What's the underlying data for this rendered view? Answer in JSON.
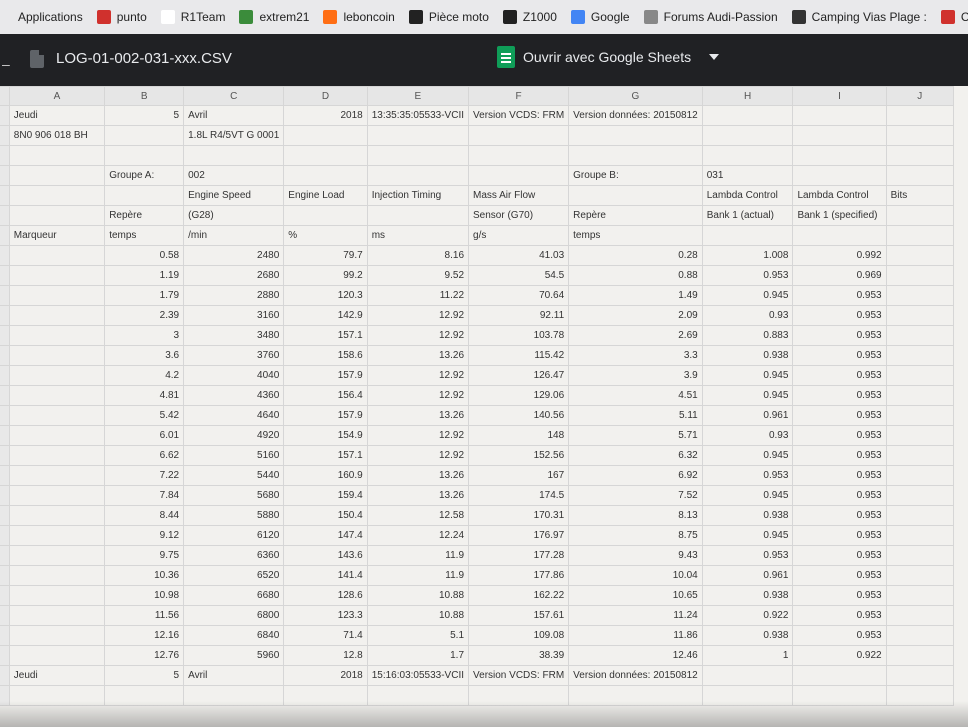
{
  "bookmarks": [
    {
      "label": "Applications",
      "icon": "apps-icon",
      "color": "#e9e9eb"
    },
    {
      "label": "punto",
      "icon": "fiat-icon",
      "color": "#d0312d"
    },
    {
      "label": "R1Team",
      "icon": "page-icon",
      "color": "#ffffff"
    },
    {
      "label": "extrem21",
      "icon": "extrem-icon",
      "color": "#3b8c3b"
    },
    {
      "label": "leboncoin",
      "icon": "leboncoin-icon",
      "color": "#ff6e14"
    },
    {
      "label": "Pièce moto",
      "icon": "moto-icon",
      "color": "#222222"
    },
    {
      "label": "Z1000",
      "icon": "z1000-icon",
      "color": "#222222"
    },
    {
      "label": "Google",
      "icon": "google-icon",
      "color": "#4285f4"
    },
    {
      "label": "Forums Audi-Passion",
      "icon": "audi-icon",
      "color": "#888888"
    },
    {
      "label": "Camping Vias Plage :",
      "icon": "camping-icon",
      "color": "#333333"
    },
    {
      "label": "Clés mix",
      "icon": "cles-icon",
      "color": "#d0312d"
    }
  ],
  "viewer": {
    "file_name": "LOG-01-002-031-xxx.CSV",
    "open_with_label": "Ouvrir avec Google Sheets",
    "sheets_color": "#0f9d58"
  },
  "sheet": {
    "columns": [
      "A",
      "B",
      "C",
      "D",
      "E",
      "F",
      "G",
      "H",
      "I",
      "J"
    ],
    "header_rows": [
      {
        "num": "",
        "cells": [
          [
            "Jeudi",
            "txt"
          ],
          [
            "5",
            "num"
          ],
          [
            "Avril",
            "txt"
          ],
          [
            "2018",
            "num"
          ],
          [
            "13:35:35:05533-VCII",
            "txt"
          ],
          [
            "Version VCDS: FRM",
            "txt"
          ],
          [
            "Version données: 20150812",
            "txt"
          ],
          [
            "",
            "txt"
          ],
          [
            "",
            "txt"
          ],
          [
            "",
            "txt"
          ]
        ]
      },
      {
        "num": "",
        "cells": [
          [
            "8N0 906 018 BH",
            "txt"
          ],
          [
            "",
            "txt"
          ],
          [
            "1.8L R4/5VT    G  0001",
            "txt"
          ],
          [
            "",
            "txt"
          ],
          [
            "",
            "txt"
          ],
          [
            "",
            "txt"
          ],
          [
            "",
            "txt"
          ],
          [
            "",
            "txt"
          ],
          [
            "",
            "txt"
          ],
          [
            "",
            "txt"
          ]
        ]
      },
      {
        "num": "",
        "cells": [
          [
            "",
            "txt"
          ],
          [
            "",
            "txt"
          ],
          [
            "",
            "txt"
          ],
          [
            "",
            "txt"
          ],
          [
            "",
            "txt"
          ],
          [
            "",
            "txt"
          ],
          [
            "",
            "txt"
          ],
          [
            "",
            "txt"
          ],
          [
            "",
            "txt"
          ],
          [
            "",
            "txt"
          ]
        ]
      },
      {
        "num": "",
        "cells": [
          [
            "",
            "txt"
          ],
          [
            "Groupe A:",
            "txt"
          ],
          [
            "002",
            "txt"
          ],
          [
            "",
            "txt"
          ],
          [
            "",
            "txt"
          ],
          [
            "",
            "txt"
          ],
          [
            "Groupe B:",
            "txt"
          ],
          [
            "031",
            "txt"
          ],
          [
            "",
            "txt"
          ],
          [
            "",
            "txt"
          ]
        ]
      },
      {
        "num": "",
        "cells": [
          [
            "",
            "txt"
          ],
          [
            "",
            "txt"
          ],
          [
            "Engine Speed",
            "txt"
          ],
          [
            "Engine Load",
            "txt"
          ],
          [
            "Injection Timing",
            "txt"
          ],
          [
            "Mass Air Flow",
            "txt"
          ],
          [
            "",
            "txt"
          ],
          [
            "Lambda Control",
            "txt"
          ],
          [
            "Lambda Control",
            "txt"
          ],
          [
            "Bits",
            "txt"
          ]
        ]
      },
      {
        "num": "",
        "cells": [
          [
            "",
            "txt"
          ],
          [
            "Repère",
            "txt"
          ],
          [
            "(G28)",
            "txt"
          ],
          [
            "",
            "txt"
          ],
          [
            "",
            "txt"
          ],
          [
            "Sensor (G70)",
            "txt"
          ],
          [
            "Repère",
            "txt"
          ],
          [
            "Bank 1 (actual)",
            "txt"
          ],
          [
            "Bank 1 (specified)",
            "txt"
          ],
          [
            "",
            "txt"
          ]
        ]
      },
      {
        "num": "",
        "cells": [
          [
            "Marqueur",
            "txt"
          ],
          [
            "temps",
            "txt"
          ],
          [
            "/min",
            "txt"
          ],
          [
            "%",
            "txt"
          ],
          [
            "ms",
            "txt"
          ],
          [
            "g/s",
            "txt"
          ],
          [
            "temps",
            "txt"
          ],
          [
            "",
            "txt"
          ],
          [
            "",
            "txt"
          ],
          [
            "",
            "txt"
          ]
        ]
      }
    ],
    "data_rows": [
      {
        "num": "",
        "cells": [
          "",
          "0.58",
          "2480",
          "79.7",
          "8.16",
          "41.03",
          "0.28",
          "1.008",
          "0.992",
          ""
        ]
      },
      {
        "num": "",
        "cells": [
          "",
          "1.19",
          "2680",
          "99.2",
          "9.52",
          "54.5",
          "0.88",
          "0.953",
          "0.969",
          ""
        ]
      },
      {
        "num": "",
        "cells": [
          "",
          "1.79",
          "2880",
          "120.3",
          "11.22",
          "70.64",
          "1.49",
          "0.945",
          "0.953",
          ""
        ]
      },
      {
        "num": "",
        "cells": [
          "",
          "2.39",
          "3160",
          "142.9",
          "12.92",
          "92.11",
          "2.09",
          "0.93",
          "0.953",
          ""
        ]
      },
      {
        "num": "",
        "cells": [
          "",
          "3",
          "3480",
          "157.1",
          "12.92",
          "103.78",
          "2.69",
          "0.883",
          "0.953",
          ""
        ]
      },
      {
        "num": "",
        "cells": [
          "",
          "3.6",
          "3760",
          "158.6",
          "13.26",
          "115.42",
          "3.3",
          "0.938",
          "0.953",
          ""
        ]
      },
      {
        "num": "",
        "cells": [
          "",
          "4.2",
          "4040",
          "157.9",
          "12.92",
          "126.47",
          "3.9",
          "0.945",
          "0.953",
          ""
        ]
      },
      {
        "num": "5",
        "cells": [
          "",
          "4.81",
          "4360",
          "156.4",
          "12.92",
          "129.06",
          "4.51",
          "0.945",
          "0.953",
          ""
        ]
      },
      {
        "num": "6",
        "cells": [
          "",
          "5.42",
          "4640",
          "157.9",
          "13.26",
          "140.56",
          "5.11",
          "0.961",
          "0.953",
          ""
        ]
      },
      {
        "num": "7",
        "cells": [
          "",
          "6.01",
          "4920",
          "154.9",
          "12.92",
          "148",
          "5.71",
          "0.93",
          "0.953",
          ""
        ]
      },
      {
        "num": "8",
        "cells": [
          "",
          "6.62",
          "5160",
          "157.1",
          "12.92",
          "152.56",
          "6.32",
          "0.945",
          "0.953",
          ""
        ]
      },
      {
        "num": "9",
        "cells": [
          "",
          "7.22",
          "5440",
          "160.9",
          "13.26",
          "167",
          "6.92",
          "0.953",
          "0.953",
          ""
        ]
      },
      {
        "num": "0",
        "cells": [
          "",
          "7.84",
          "5680",
          "159.4",
          "13.26",
          "174.5",
          "7.52",
          "0.945",
          "0.953",
          ""
        ]
      },
      {
        "num": "1",
        "cells": [
          "",
          "8.44",
          "5880",
          "150.4",
          "12.58",
          "170.31",
          "8.13",
          "0.938",
          "0.953",
          ""
        ]
      },
      {
        "num": "2",
        "cells": [
          "",
          "9.12",
          "6120",
          "147.4",
          "12.24",
          "176.97",
          "8.75",
          "0.945",
          "0.953",
          ""
        ]
      },
      {
        "num": "23",
        "cells": [
          "",
          "9.75",
          "6360",
          "143.6",
          "11.9",
          "177.28",
          "9.43",
          "0.953",
          "0.953",
          ""
        ]
      },
      {
        "num": "24",
        "cells": [
          "",
          "10.36",
          "6520",
          "141.4",
          "11.9",
          "177.86",
          "10.04",
          "0.961",
          "0.953",
          ""
        ]
      },
      {
        "num": "25",
        "cells": [
          "",
          "10.98",
          "6680",
          "128.6",
          "10.88",
          "162.22",
          "10.65",
          "0.938",
          "0.953",
          ""
        ]
      },
      {
        "num": "26",
        "cells": [
          "",
          "11.56",
          "6800",
          "123.3",
          "10.88",
          "157.61",
          "11.24",
          "0.922",
          "0.953",
          ""
        ]
      },
      {
        "num": "27",
        "cells": [
          "",
          "12.16",
          "6840",
          "71.4",
          "5.1",
          "109.08",
          "11.86",
          "0.938",
          "0.953",
          ""
        ]
      },
      {
        "num": "28",
        "cells": [
          "",
          "12.76",
          "5960",
          "12.8",
          "1.7",
          "38.39",
          "12.46",
          "1",
          "0.922",
          ""
        ]
      }
    ],
    "footer_rows": [
      {
        "num": "29",
        "cells": [
          [
            "Jeudi",
            "txt"
          ],
          [
            "5",
            "num"
          ],
          [
            "Avril",
            "txt"
          ],
          [
            "2018",
            "num"
          ],
          [
            "15:16:03:05533-VCII",
            "txt"
          ],
          [
            "Version VCDS: FRM",
            "txt"
          ],
          [
            "Version données: 20150812",
            "txt"
          ],
          [
            "",
            "txt"
          ],
          [
            "",
            "txt"
          ],
          [
            "",
            "txt"
          ]
        ]
      },
      {
        "num": "30",
        "cells": [
          [
            "",
            "txt"
          ],
          [
            "",
            "txt"
          ],
          [
            "",
            "txt"
          ],
          [
            "",
            "txt"
          ],
          [
            "",
            "txt"
          ],
          [
            "",
            "txt"
          ],
          [
            "",
            "txt"
          ],
          [
            "",
            "txt"
          ],
          [
            "",
            "txt"
          ],
          [
            "",
            "txt"
          ]
        ]
      }
    ]
  }
}
